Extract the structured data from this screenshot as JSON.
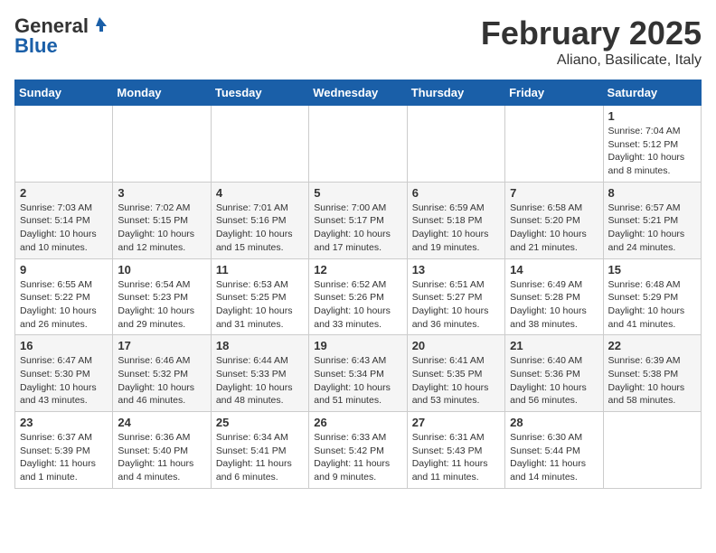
{
  "logo": {
    "general": "General",
    "blue": "Blue"
  },
  "title": "February 2025",
  "subtitle": "Aliano, Basilicate, Italy",
  "days_of_week": [
    "Sunday",
    "Monday",
    "Tuesday",
    "Wednesday",
    "Thursday",
    "Friday",
    "Saturday"
  ],
  "weeks": [
    [
      {
        "day": "",
        "info": ""
      },
      {
        "day": "",
        "info": ""
      },
      {
        "day": "",
        "info": ""
      },
      {
        "day": "",
        "info": ""
      },
      {
        "day": "",
        "info": ""
      },
      {
        "day": "",
        "info": ""
      },
      {
        "day": "1",
        "info": "Sunrise: 7:04 AM\nSunset: 5:12 PM\nDaylight: 10 hours\nand 8 minutes."
      }
    ],
    [
      {
        "day": "2",
        "info": "Sunrise: 7:03 AM\nSunset: 5:14 PM\nDaylight: 10 hours\nand 10 minutes."
      },
      {
        "day": "3",
        "info": "Sunrise: 7:02 AM\nSunset: 5:15 PM\nDaylight: 10 hours\nand 12 minutes."
      },
      {
        "day": "4",
        "info": "Sunrise: 7:01 AM\nSunset: 5:16 PM\nDaylight: 10 hours\nand 15 minutes."
      },
      {
        "day": "5",
        "info": "Sunrise: 7:00 AM\nSunset: 5:17 PM\nDaylight: 10 hours\nand 17 minutes."
      },
      {
        "day": "6",
        "info": "Sunrise: 6:59 AM\nSunset: 5:18 PM\nDaylight: 10 hours\nand 19 minutes."
      },
      {
        "day": "7",
        "info": "Sunrise: 6:58 AM\nSunset: 5:20 PM\nDaylight: 10 hours\nand 21 minutes."
      },
      {
        "day": "8",
        "info": "Sunrise: 6:57 AM\nSunset: 5:21 PM\nDaylight: 10 hours\nand 24 minutes."
      }
    ],
    [
      {
        "day": "9",
        "info": "Sunrise: 6:55 AM\nSunset: 5:22 PM\nDaylight: 10 hours\nand 26 minutes."
      },
      {
        "day": "10",
        "info": "Sunrise: 6:54 AM\nSunset: 5:23 PM\nDaylight: 10 hours\nand 29 minutes."
      },
      {
        "day": "11",
        "info": "Sunrise: 6:53 AM\nSunset: 5:25 PM\nDaylight: 10 hours\nand 31 minutes."
      },
      {
        "day": "12",
        "info": "Sunrise: 6:52 AM\nSunset: 5:26 PM\nDaylight: 10 hours\nand 33 minutes."
      },
      {
        "day": "13",
        "info": "Sunrise: 6:51 AM\nSunset: 5:27 PM\nDaylight: 10 hours\nand 36 minutes."
      },
      {
        "day": "14",
        "info": "Sunrise: 6:49 AM\nSunset: 5:28 PM\nDaylight: 10 hours\nand 38 minutes."
      },
      {
        "day": "15",
        "info": "Sunrise: 6:48 AM\nSunset: 5:29 PM\nDaylight: 10 hours\nand 41 minutes."
      }
    ],
    [
      {
        "day": "16",
        "info": "Sunrise: 6:47 AM\nSunset: 5:30 PM\nDaylight: 10 hours\nand 43 minutes."
      },
      {
        "day": "17",
        "info": "Sunrise: 6:46 AM\nSunset: 5:32 PM\nDaylight: 10 hours\nand 46 minutes."
      },
      {
        "day": "18",
        "info": "Sunrise: 6:44 AM\nSunset: 5:33 PM\nDaylight: 10 hours\nand 48 minutes."
      },
      {
        "day": "19",
        "info": "Sunrise: 6:43 AM\nSunset: 5:34 PM\nDaylight: 10 hours\nand 51 minutes."
      },
      {
        "day": "20",
        "info": "Sunrise: 6:41 AM\nSunset: 5:35 PM\nDaylight: 10 hours\nand 53 minutes."
      },
      {
        "day": "21",
        "info": "Sunrise: 6:40 AM\nSunset: 5:36 PM\nDaylight: 10 hours\nand 56 minutes."
      },
      {
        "day": "22",
        "info": "Sunrise: 6:39 AM\nSunset: 5:38 PM\nDaylight: 10 hours\nand 58 minutes."
      }
    ],
    [
      {
        "day": "23",
        "info": "Sunrise: 6:37 AM\nSunset: 5:39 PM\nDaylight: 11 hours\nand 1 minute."
      },
      {
        "day": "24",
        "info": "Sunrise: 6:36 AM\nSunset: 5:40 PM\nDaylight: 11 hours\nand 4 minutes."
      },
      {
        "day": "25",
        "info": "Sunrise: 6:34 AM\nSunset: 5:41 PM\nDaylight: 11 hours\nand 6 minutes."
      },
      {
        "day": "26",
        "info": "Sunrise: 6:33 AM\nSunset: 5:42 PM\nDaylight: 11 hours\nand 9 minutes."
      },
      {
        "day": "27",
        "info": "Sunrise: 6:31 AM\nSunset: 5:43 PM\nDaylight: 11 hours\nand 11 minutes."
      },
      {
        "day": "28",
        "info": "Sunrise: 6:30 AM\nSunset: 5:44 PM\nDaylight: 11 hours\nand 14 minutes."
      },
      {
        "day": "",
        "info": ""
      }
    ]
  ]
}
